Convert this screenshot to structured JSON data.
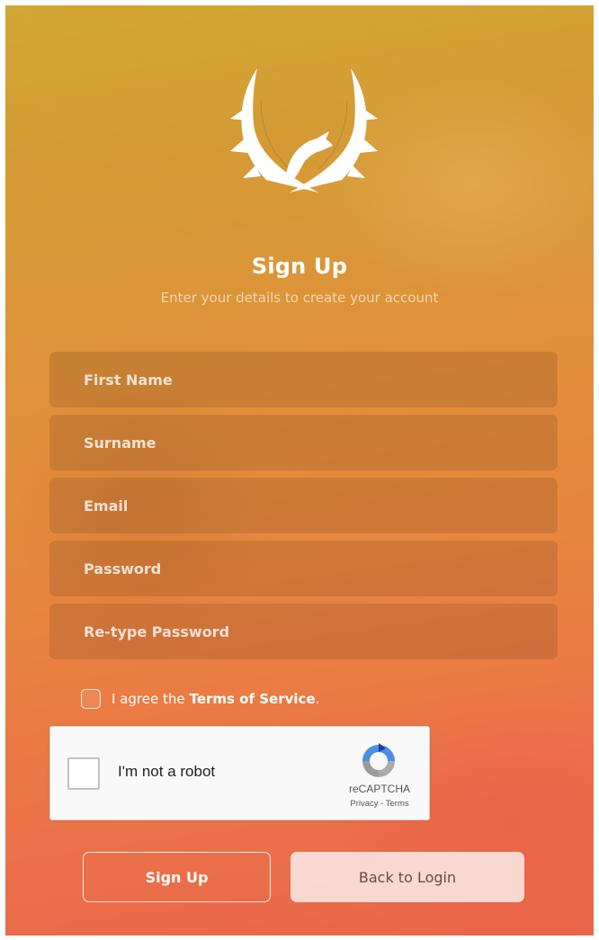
{
  "brand": {
    "logo_icon": "phoenix-logo-icon"
  },
  "header": {
    "title": "Sign Up",
    "subtitle": "Enter your details to create your account"
  },
  "form": {
    "fields": [
      {
        "name": "first_name",
        "placeholder": "First Name",
        "value": ""
      },
      {
        "name": "surname",
        "placeholder": "Surname",
        "value": ""
      },
      {
        "name": "email",
        "placeholder": "Email",
        "value": ""
      },
      {
        "name": "password",
        "placeholder": "Password",
        "value": ""
      },
      {
        "name": "retype_password",
        "placeholder": "Re-type Password",
        "value": ""
      }
    ],
    "terms": {
      "prefix": "I agree the",
      "link": "Terms of Service",
      "suffix": ".",
      "checked": false
    },
    "recaptcha": {
      "label": "I'm not a robot",
      "brand": "reCAPTCHA",
      "links": "Privacy - Terms",
      "checked": false
    }
  },
  "actions": {
    "submit_label": "Sign Up",
    "back_label": "Back to Login"
  },
  "colors": {
    "background_top": "#d1a634",
    "background_bottom": "#ea654b",
    "text": "#ffffff",
    "back_button_bg": "#fae1dc"
  }
}
